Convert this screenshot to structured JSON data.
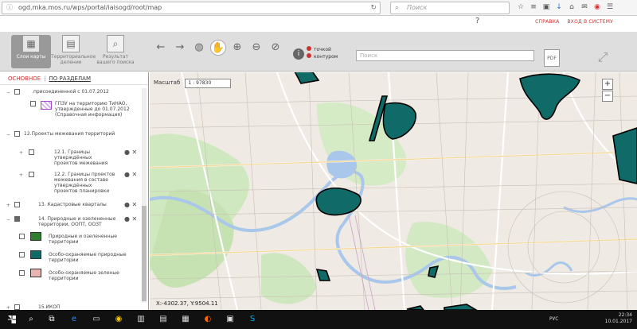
{
  "browser": {
    "url": "ogd.mka.mos.ru/wps/portal/iaisogd/root/map",
    "search_placeholder": "Поиск"
  },
  "app": {
    "links": {
      "help": "СПРАВКА",
      "login": "ВХОД В СИСТЕМУ"
    },
    "tools": [
      {
        "label": "Слои карты",
        "active": true
      },
      {
        "label": "Территориальное деление",
        "active": false
      },
      {
        "label": "Результат вашего поиска",
        "active": false
      }
    ],
    "mode": {
      "point": "точкой",
      "contour": "контуром"
    },
    "search_placeholder": "Поиск",
    "pdf_label": "PDF",
    "panel": {
      "tab_main": "ОСНОВНОЕ",
      "tab_sep": "|",
      "tab_sections": "ПО РАЗДЕЛАМ",
      "layers": [
        {
          "text": "присоединенной с 01.07.2012"
        },
        {
          "text": "ГПЗУ на территорию ТиНАО, утвержденные до 01.07.2012 (Справочная информация)"
        },
        {
          "text": "12.Проекты межевания территорий"
        },
        {
          "text": "12.1. Границы утверждённых проектов межевания"
        },
        {
          "text": "12.2. Границы проектов межевания в составе утверждённых проектов планировки"
        },
        {
          "text": "13. Кадастровые кварталы"
        },
        {
          "text": "14. Природные и озелененные территории, ООПТ, ООЗТ"
        },
        {
          "text": "Природные и озелененные территории"
        },
        {
          "text": "Особо-охраняемые природные территории"
        },
        {
          "text": "Особо-охраняемые зеленые территории"
        },
        {
          "text": "15.ИКОП"
        }
      ]
    },
    "map": {
      "scale_label": "Масштаб",
      "scale_value": "1 : 97830",
      "coords": "X:-4302.37, Y:9504.11"
    }
  },
  "taskbar": {
    "lang": "РУС",
    "time": "22:34",
    "date": "10.01.2017"
  },
  "colors": {
    "green_fill": "#0f6a68",
    "accent_red": "#cc3333"
  }
}
